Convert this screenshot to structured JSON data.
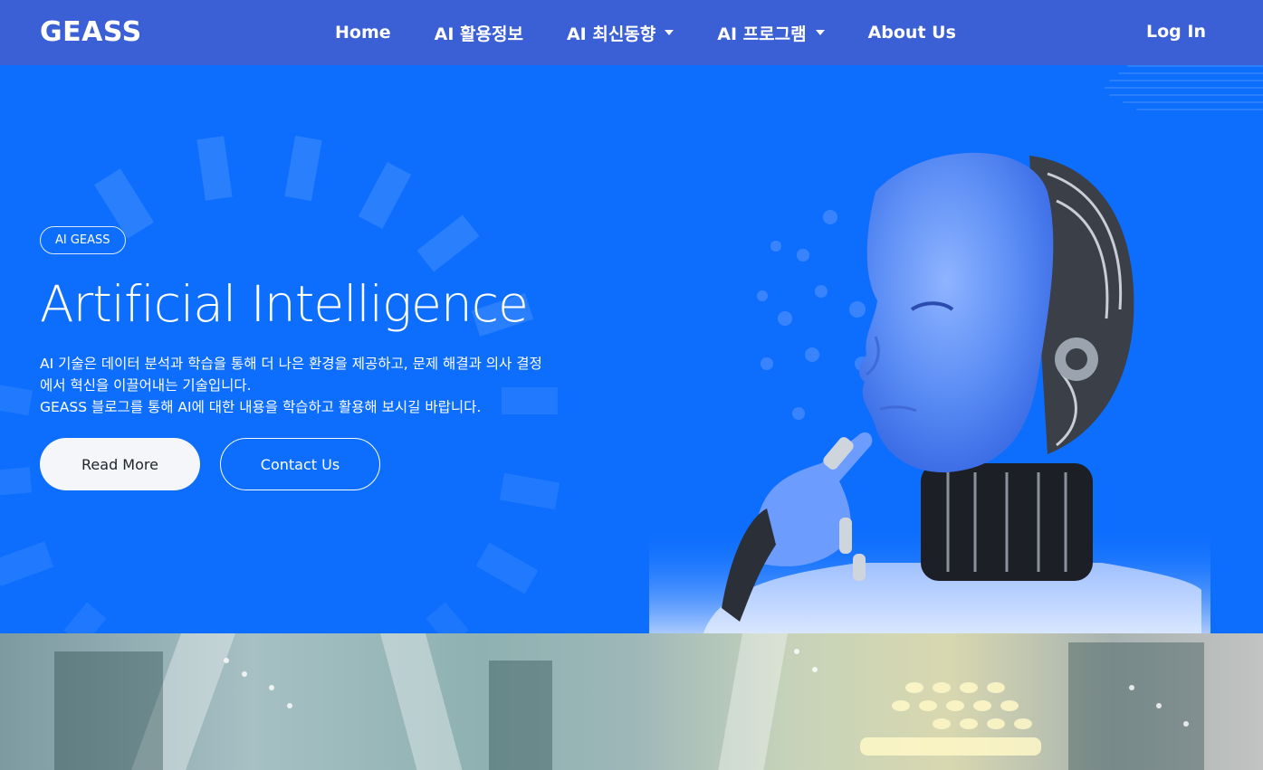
{
  "navbar": {
    "brand": "GEASS",
    "items": [
      {
        "label": "Home",
        "dropdown": false
      },
      {
        "label": "AI 활용정보",
        "dropdown": false
      },
      {
        "label": "AI 최신동향",
        "dropdown": true
      },
      {
        "label": "AI 프로그램",
        "dropdown": true
      },
      {
        "label": "About Us",
        "dropdown": false
      }
    ],
    "login": "Log In"
  },
  "hero": {
    "badge": "AI GEASS",
    "title": "Artificial Intelligence",
    "description": [
      "AI 기술은 데이터 분석과 학습을 통해 더 나은 환경을 제공하고, 문제 해결과 의사 결정",
      "에서 혁신을 이끌어내는 기술입니다.",
      "GEASS 블로그를 통해 AI에 대한 내용을 학습하고 활용해 보시길 바랍니다."
    ],
    "buttons": {
      "read_more": "Read More",
      "contact": "Contact Us"
    }
  },
  "colors": {
    "navbar": "#3b5fd4",
    "hero": "#0d6efd",
    "text": "#ffffff"
  },
  "icons": [
    "caret-down-icon",
    "robot-illustration",
    "city-photo"
  ]
}
